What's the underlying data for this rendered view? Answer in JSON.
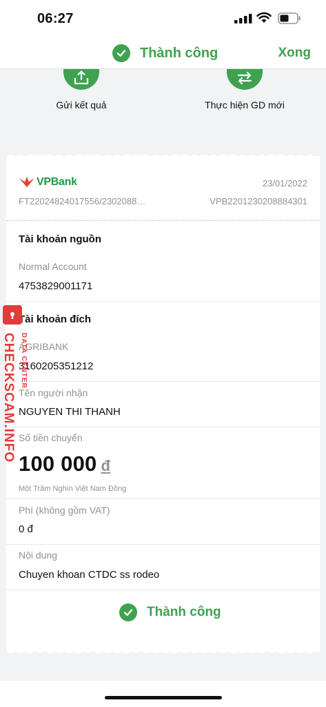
{
  "status_bar": {
    "time": "06:27"
  },
  "nav": {
    "title": "Thành công",
    "done_label": "Xong"
  },
  "actions": {
    "send_result": "Gửi kết quả",
    "new_transaction": "Thực hiện GD mới"
  },
  "receipt": {
    "bank_name": "VPBank",
    "date": "23/01/2022",
    "ref_left": "FT22024824017556/2302088…",
    "ref_right": "VPB2201230208884301",
    "source": {
      "title": "Tài khoản nguồn",
      "account_type": "Normal Account",
      "account_number": "4753829001171"
    },
    "destination": {
      "title": "Tài khoản đích",
      "bank": "AGRIBANK",
      "account_number": "3160205351212"
    },
    "recipient": {
      "label": "Tên người nhận",
      "value": "NGUYEN THI THANH"
    },
    "amount": {
      "label": "Số tiền chuyển",
      "value": "100 000",
      "currency": "đ",
      "in_words": "Một Trăm Nghìn Việt Nam Đồng"
    },
    "fee": {
      "label": "Phí (không gồm VAT)",
      "value": "0 đ"
    },
    "content": {
      "label": "Nội dung",
      "value": "Chuyen khoan CTDC ss rodeo"
    },
    "status": "Thành công"
  },
  "watermark": {
    "main": "CHECKSCAM.INFO",
    "sub": "DATA CENTER"
  },
  "colors": {
    "accent_green": "#3fa24f",
    "watermark_red": "#e23b3b",
    "logo_red": "#e5412d"
  },
  "icons": [
    "cellular-signal-icon",
    "wifi-icon",
    "battery-icon",
    "checkmark-circle-icon",
    "share-upload-icon",
    "swap-arrows-icon",
    "vpbank-logo-icon",
    "lock-icon"
  ]
}
